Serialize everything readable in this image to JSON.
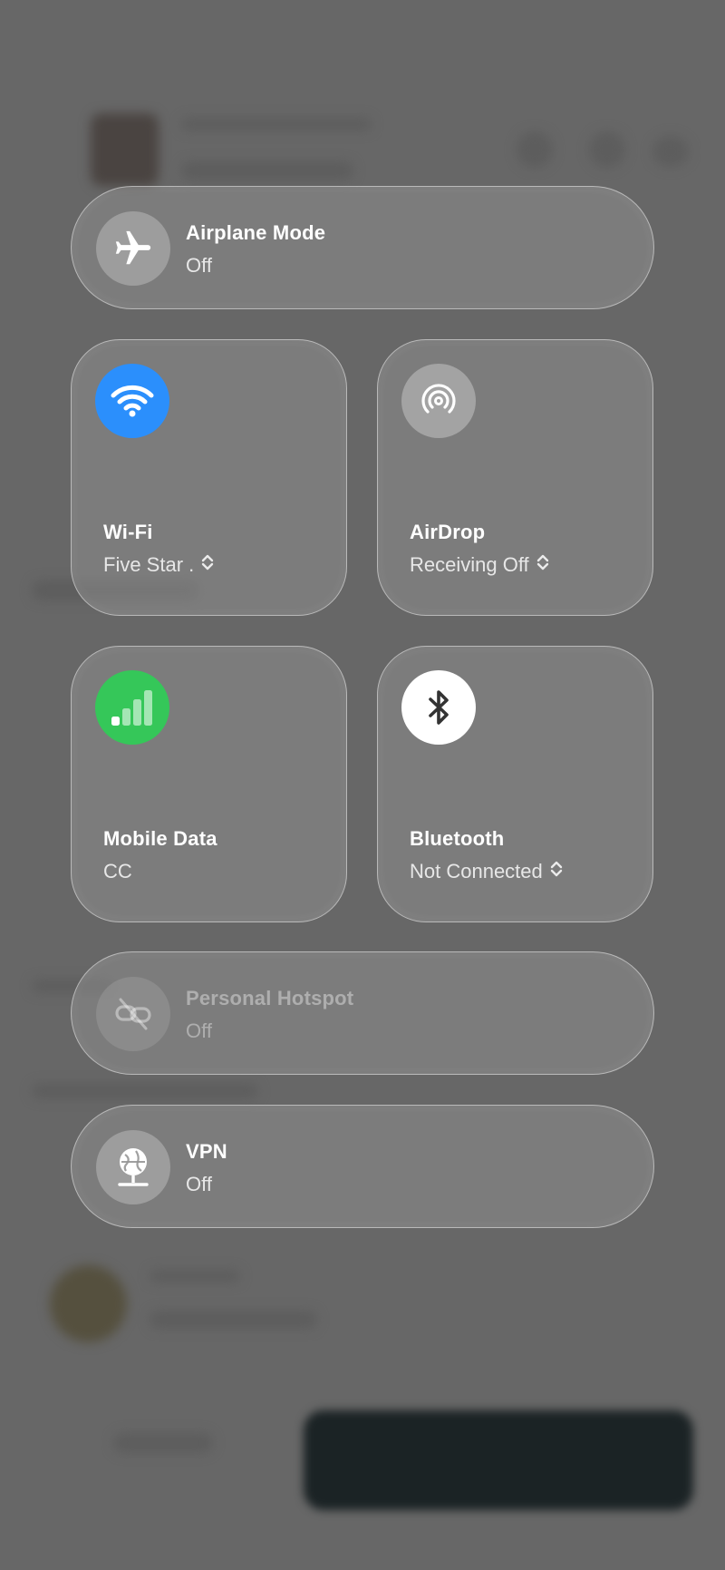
{
  "airplane": {
    "title": "Airplane Mode",
    "status": "Off"
  },
  "wifi": {
    "title": "Wi-Fi",
    "status": "Five Star .",
    "color": "#2b8ffc"
  },
  "airdrop": {
    "title": "AirDrop",
    "status": "Receiving Off"
  },
  "mobile_data": {
    "title": "Mobile Data",
    "status": "CC",
    "color": "#35c759"
  },
  "bluetooth": {
    "title": "Bluetooth",
    "status": "Not Connected"
  },
  "hotspot": {
    "title": "Personal Hotspot",
    "status": "Off"
  },
  "vpn": {
    "title": "VPN",
    "status": "Off"
  },
  "icons": [
    "airplane-icon",
    "wifi-icon",
    "airdrop-icon",
    "cellular-icon",
    "bluetooth-icon",
    "hotspot-icon",
    "vpn-icon",
    "chevron-updown-icon"
  ]
}
